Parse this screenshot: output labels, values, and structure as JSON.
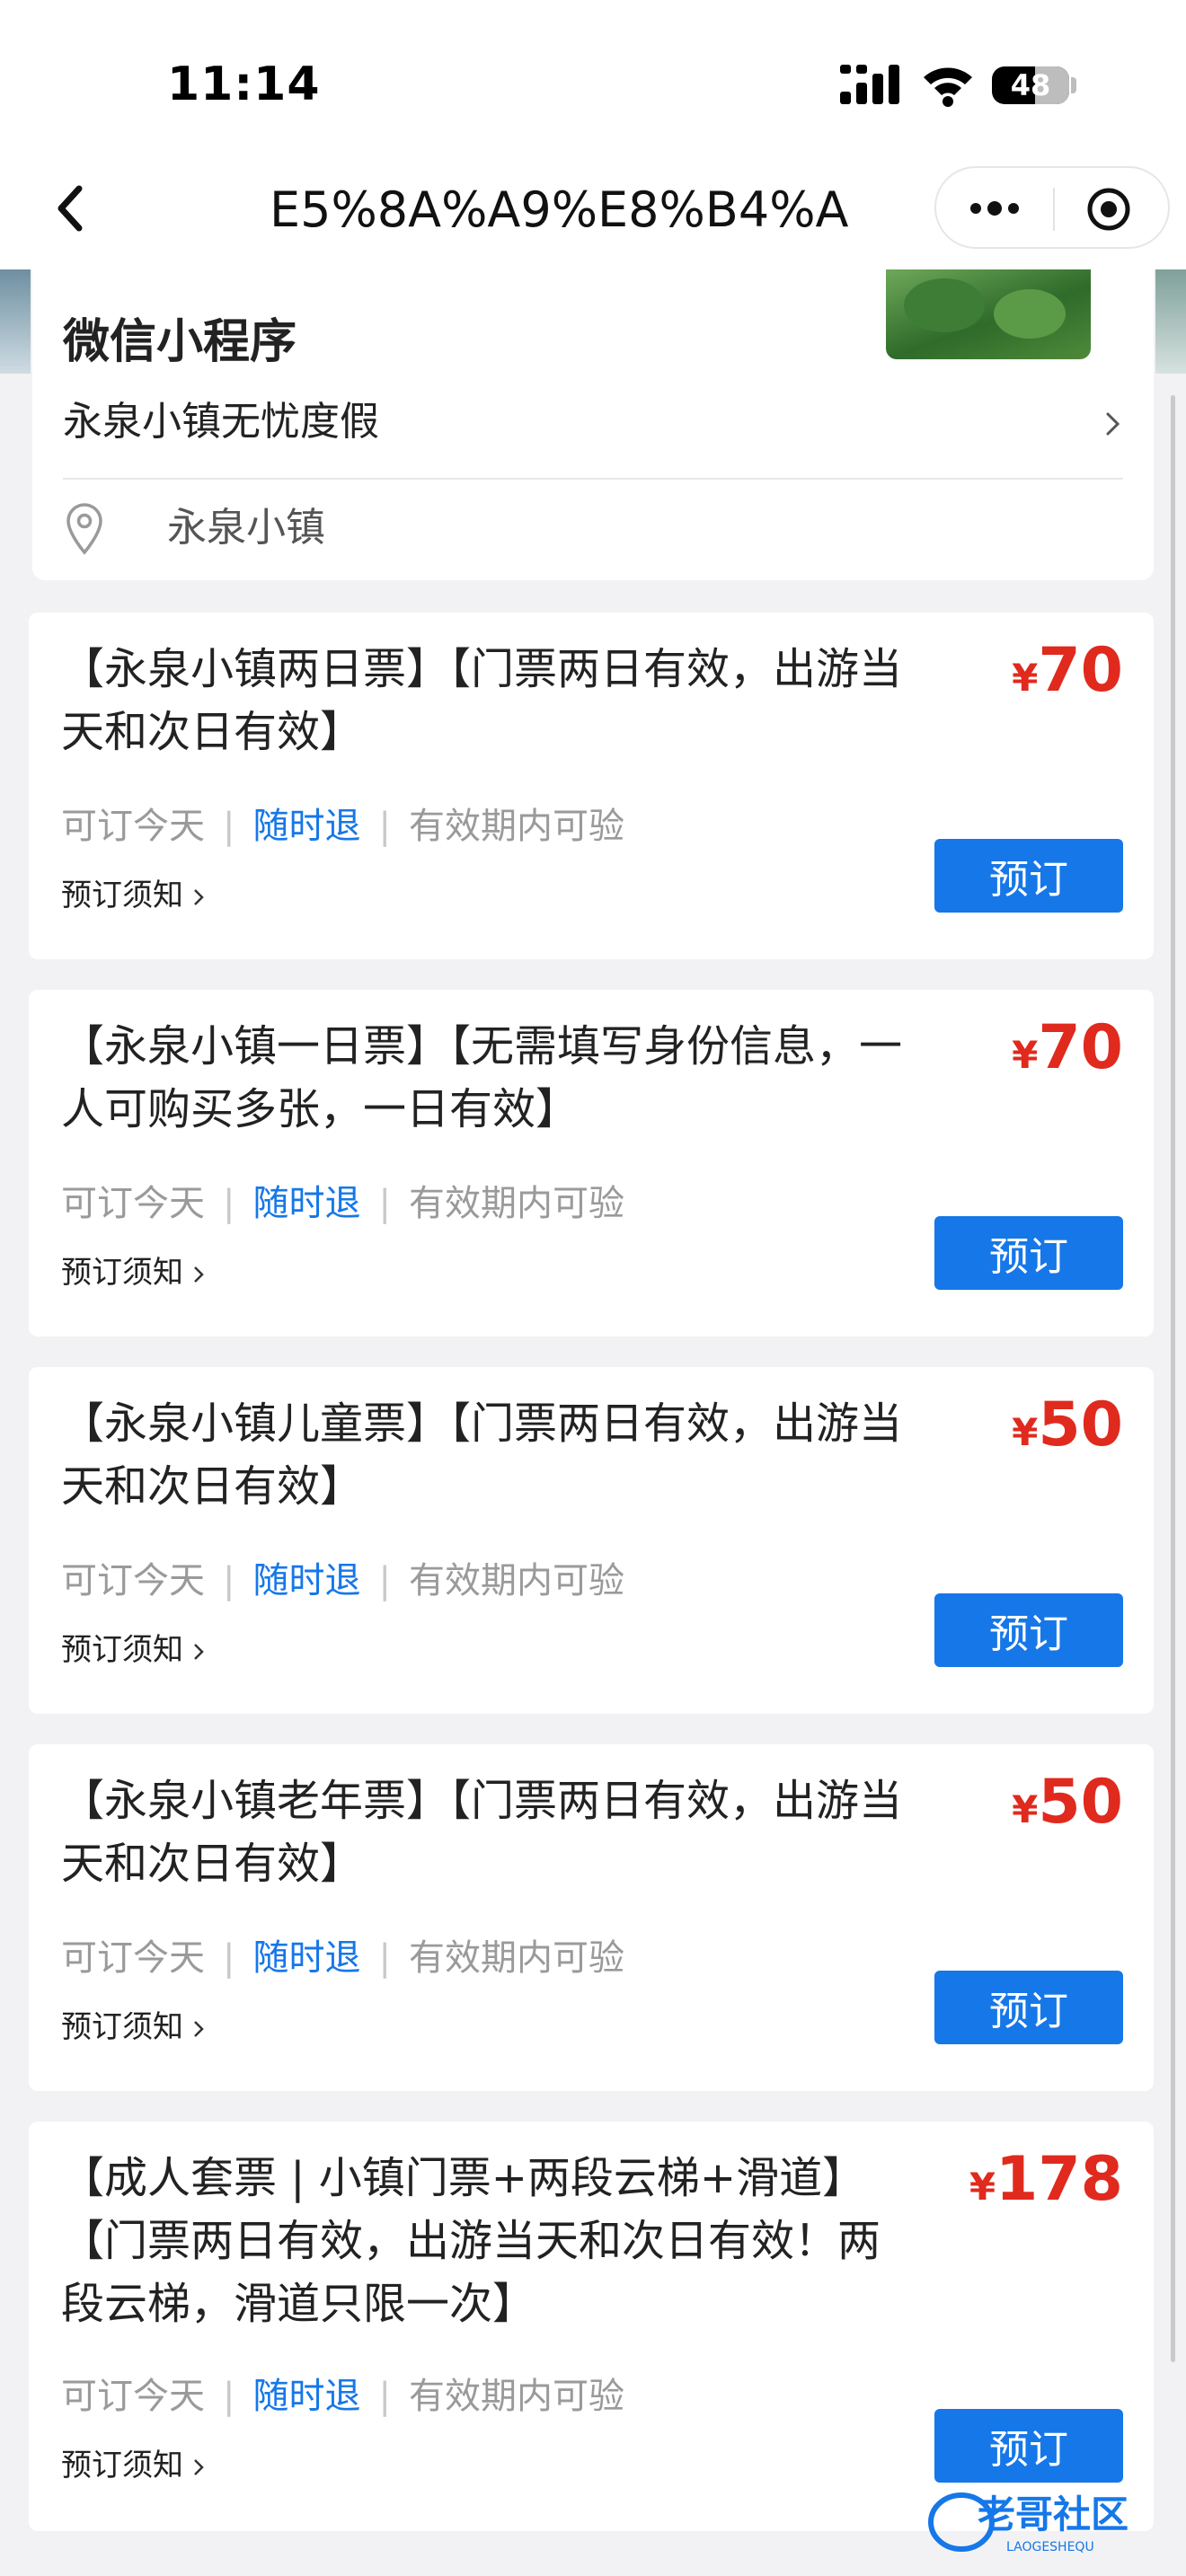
{
  "status_bar": {
    "time": "11:14",
    "battery": "48"
  },
  "nav": {
    "url": "E5%8A%A9%E8%B4%A"
  },
  "header": {
    "mini_program_label": "微信小程序",
    "shop_name": "永泉小镇无忧度假",
    "location": "永泉小镇"
  },
  "tickets": [
    {
      "name": "【永泉小镇两日票】【门票两日有效，出游当天和次日有效】",
      "currency": "¥",
      "price": "70",
      "tag1": "可订今天",
      "tag2": "随时退",
      "tag3": "有效期内可验",
      "notice": "预订须知",
      "button": "预订"
    },
    {
      "name": "【永泉小镇一日票】【无需填写身份信息，一人可购买多张，一日有效】",
      "currency": "¥",
      "price": "70",
      "tag1": "可订今天",
      "tag2": "随时退",
      "tag3": "有效期内可验",
      "notice": "预订须知",
      "button": "预订"
    },
    {
      "name": "【永泉小镇儿童票】【门票两日有效，出游当天和次日有效】",
      "currency": "¥",
      "price": "50",
      "tag1": "可订今天",
      "tag2": "随时退",
      "tag3": "有效期内可验",
      "notice": "预订须知",
      "button": "预订"
    },
    {
      "name": "【永泉小镇老年票】【门票两日有效，出游当天和次日有效】",
      "currency": "¥",
      "price": "50",
      "tag1": "可订今天",
      "tag2": "随时退",
      "tag3": "有效期内可验",
      "notice": "预订须知",
      "button": "预订"
    },
    {
      "name": "【成人套票 | 小镇门票+两段云梯+滑道】【门票两日有效，出游当天和次日有效！两段云梯，滑道只限一次】",
      "currency": "¥",
      "price": "178",
      "tag1": "可订今天",
      "tag2": "随时退",
      "tag3": "有效期内可验",
      "notice": "预订须知",
      "button": "预订"
    }
  ],
  "watermark": {
    "text": "老哥社区",
    "subtext": "LAOGESHEQU"
  },
  "colors": {
    "accent_blue": "#1677e8",
    "price_red": "#e02a1e",
    "background": "#f2f2f4"
  }
}
